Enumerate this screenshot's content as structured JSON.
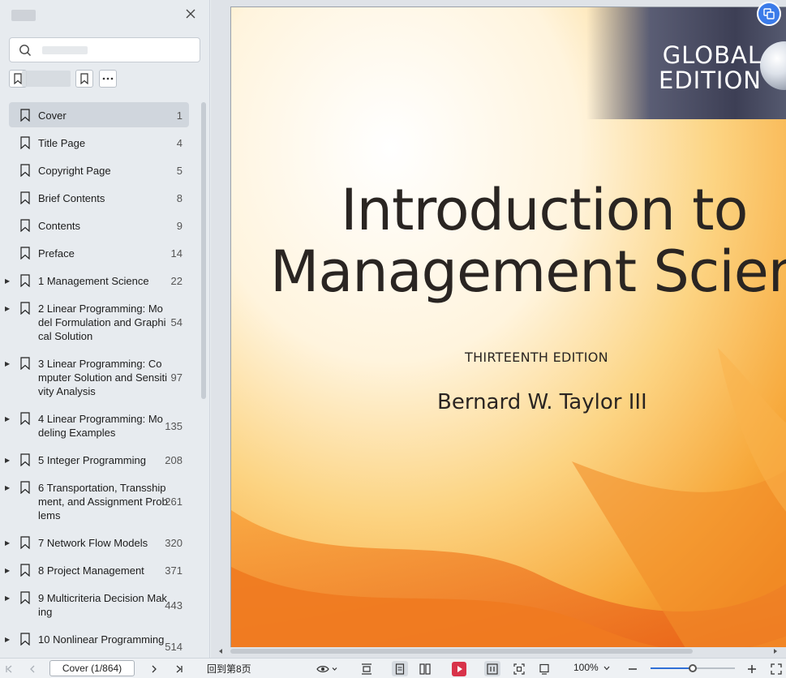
{
  "sidebar": {
    "search": {
      "placeholder": ""
    },
    "toc": [
      {
        "label": "Cover",
        "page": "1",
        "active": true,
        "expandable": false
      },
      {
        "label": "Title Page",
        "page": "4",
        "active": false,
        "expandable": false
      },
      {
        "label": "Copyright Page",
        "page": "5",
        "active": false,
        "expandable": false
      },
      {
        "label": "Brief Contents",
        "page": "8",
        "active": false,
        "expandable": false
      },
      {
        "label": "Contents",
        "page": "9",
        "active": false,
        "expandable": false
      },
      {
        "label": "Preface",
        "page": "14",
        "active": false,
        "expandable": false
      },
      {
        "label": "1 Management Science",
        "page": "22",
        "active": false,
        "expandable": true
      },
      {
        "label": "2 Linear Programming: Model Formulation and Graphical Solution",
        "page": "54",
        "active": false,
        "expandable": true
      },
      {
        "label": "3 Linear Programming: Computer Solution and Sensitivity Analysis",
        "page": "97",
        "active": false,
        "expandable": true
      },
      {
        "label": "4 Linear Programming: Modeling Examples",
        "page": "135",
        "active": false,
        "expandable": true
      },
      {
        "label": "5 Integer Programming",
        "page": "208",
        "active": false,
        "expandable": true
      },
      {
        "label": "6 Transportation, Transshipment, and Assignment Problems",
        "page": "261",
        "active": false,
        "expandable": true
      },
      {
        "label": "7 Network Flow Models",
        "page": "320",
        "active": false,
        "expandable": true
      },
      {
        "label": "8 Project Management",
        "page": "371",
        "active": false,
        "expandable": true
      },
      {
        "label": "9 Multicriteria Decision Making",
        "page": "443",
        "active": false,
        "expandable": true
      },
      {
        "label": "10 Nonlinear Programming",
        "page": "514",
        "active": false,
        "expandable": true
      }
    ]
  },
  "document": {
    "edition_badge_line1": "GLOBAL",
    "edition_badge_line2": "EDITION",
    "title_line1": "Introduction to",
    "title_line2": "Management Science",
    "edition": "THIRTEENTH EDITION",
    "author": "Bernard W. Taylor III"
  },
  "bottombar": {
    "page_indicator": "Cover (1/864)",
    "goto_label": "回到第8页",
    "zoom": "100%",
    "zoom_fraction": 0.5
  },
  "colors": {
    "accent": "#2f6fd6",
    "play": "#d8334a",
    "cover_orange": "#f58a1f"
  }
}
